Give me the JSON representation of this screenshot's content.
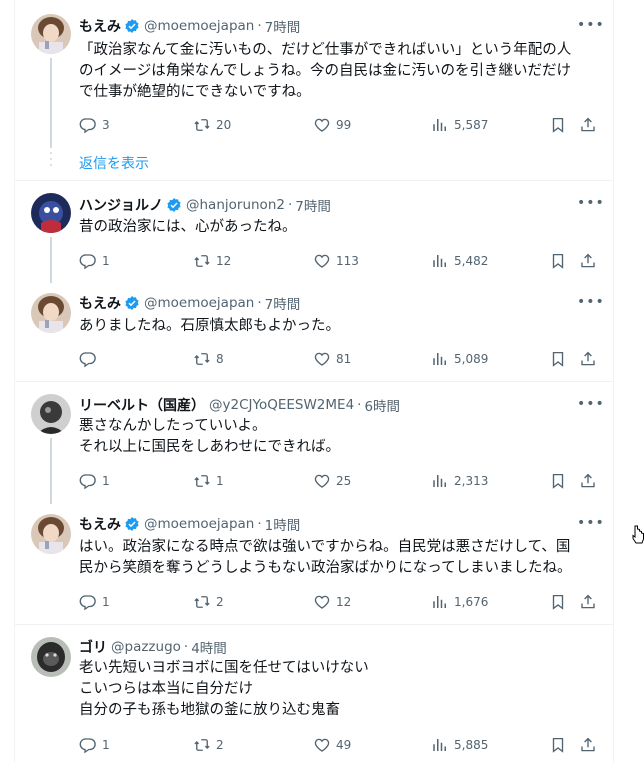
{
  "show_replies_label": "返信を表示",
  "tweets": [
    {
      "name": "もえみ",
      "verified": true,
      "handle": "@moemoejapan",
      "time": "7時間",
      "lines": [
        "「政治家なんて金に汚いもの、だけど仕事ができればいい」という年配の人",
        "のイメージは角栄なんでしょうね。今の自民は金に汚いのを引き継いだだけ",
        "で仕事が絶望的にできないですね。"
      ],
      "reply_count": "3",
      "retweet_count": "20",
      "like_count": "99",
      "view_count": "5,587"
    },
    {
      "name": "ハンジョルノ",
      "verified": true,
      "handle": "@hanjorunon2",
      "time": "7時間",
      "lines": [
        "昔の政治家には、心があったね。"
      ],
      "reply_count": "1",
      "retweet_count": "12",
      "like_count": "113",
      "view_count": "5,482"
    },
    {
      "name": "もえみ",
      "verified": true,
      "handle": "@moemoejapan",
      "time": "7時間",
      "lines": [
        "ありましたね。石原慎太郎もよかった。"
      ],
      "reply_count": "",
      "retweet_count": "8",
      "like_count": "81",
      "view_count": "5,089"
    },
    {
      "name": "リーベルト（国産）",
      "verified": false,
      "handle": "@y2CJYoQEESW2ME4",
      "time": "6時間",
      "lines": [
        "悪さなんかしたっていいよ。",
        "それ以上に国民をしあわせにできれば。"
      ],
      "reply_count": "1",
      "retweet_count": "1",
      "like_count": "25",
      "view_count": "2,313"
    },
    {
      "name": "もえみ",
      "verified": true,
      "handle": "@moemoejapan",
      "time": "1時間",
      "lines": [
        "はい。政治家になる時点で欲は強いですからね。自民党は悪さだけして、国",
        "民から笑顔を奪うどうしようもない政治家ばかりになってしまいましたね。"
      ],
      "reply_count": "1",
      "retweet_count": "2",
      "like_count": "12",
      "view_count": "1,676"
    },
    {
      "name": "ゴリ",
      "verified": false,
      "handle": "@pazzugo",
      "time": "4時間",
      "lines": [
        "老い先短いヨボヨボに国を任せてはいけない",
        "こいつらは本当に自分だけ",
        "自分の子も孫も地獄の釜に放り込む鬼畜"
      ],
      "reply_count": "1",
      "retweet_count": "2",
      "like_count": "49",
      "view_count": "5,885"
    }
  ],
  "icons": {
    "reply": "reply-icon",
    "retweet": "retweet-icon",
    "like": "heart-icon",
    "views": "views-icon",
    "bookmark": "bookmark-icon",
    "share": "share-icon",
    "more": "more-icon",
    "verified": "verified-badge-icon"
  },
  "colors": {
    "accent": "#1d9bf0",
    "muted": "#536471",
    "text": "#0f1419",
    "border": "#eff3f4"
  }
}
